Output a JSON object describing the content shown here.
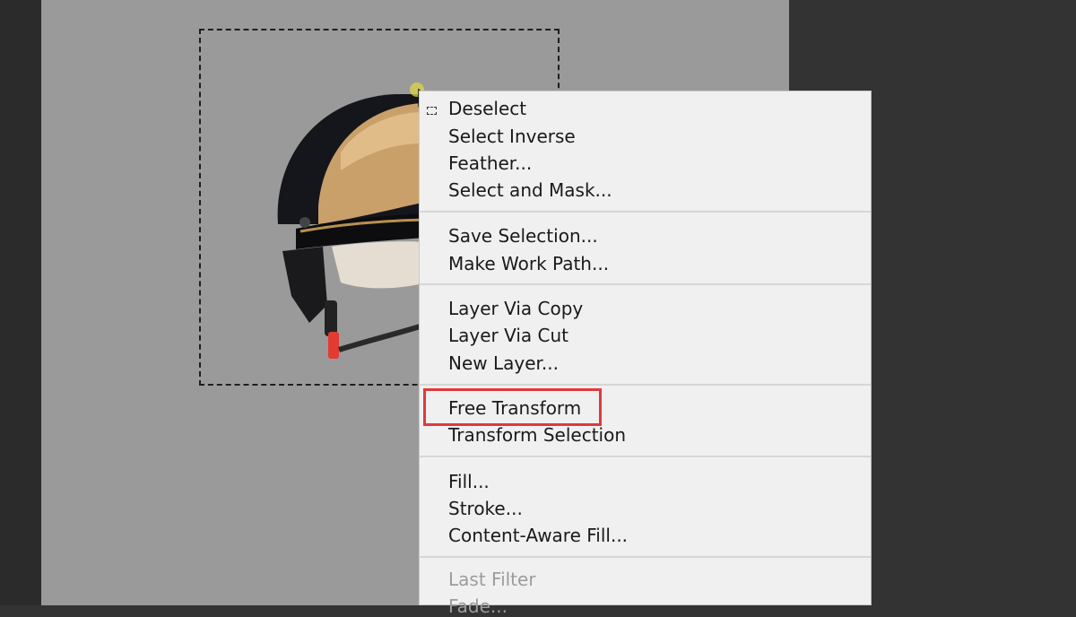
{
  "context_menu": {
    "items": [
      {
        "label": "Deselect",
        "disabled": false,
        "icon": "marquee-icon"
      },
      {
        "label": "Select Inverse",
        "disabled": false
      },
      {
        "label": "Feather...",
        "disabled": false
      },
      {
        "label": "Select and Mask...",
        "disabled": false
      },
      {
        "label": "Save Selection...",
        "disabled": false
      },
      {
        "label": "Make Work Path...",
        "disabled": false
      },
      {
        "label": "Layer Via Copy",
        "disabled": false
      },
      {
        "label": "Layer Via Cut",
        "disabled": false
      },
      {
        "label": "New Layer...",
        "disabled": false
      },
      {
        "label": "Free Transform",
        "disabled": false,
        "highlighted": true
      },
      {
        "label": "Transform Selection",
        "disabled": false
      },
      {
        "label": "Fill...",
        "disabled": false
      },
      {
        "label": "Stroke...",
        "disabled": false
      },
      {
        "label": "Content-Aware Fill...",
        "disabled": false
      },
      {
        "label": "Last Filter",
        "disabled": true
      },
      {
        "label": "Fade...",
        "disabled": true
      }
    ]
  },
  "colors": {
    "highlight_border": "#e03a3a",
    "canvas_bg": "#9a9a9a",
    "workspace_bg": "#333333",
    "menu_bg": "#f0f0f0"
  }
}
